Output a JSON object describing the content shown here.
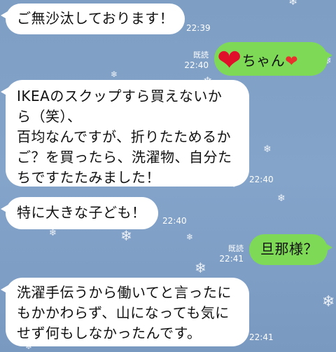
{
  "messages": [
    {
      "text": "ご無沙汰しております！",
      "time": "22:39"
    },
    {
      "prefix_icon": "heart-icon",
      "text": "ちゃん",
      "suffix_icon": "heart-icon",
      "read": "既読",
      "time": "22:40"
    },
    {
      "lines": [
        "IKEAのスクップすら買えないか",
        "ら（笑）、",
        "百均なんですが、折りたためるか",
        "ご？を買ったら、洗濯物、自分た",
        "ちですたたみました！"
      ],
      "time": "22:40"
    },
    {
      "text": "特に大きな子ども！",
      "time": "22:40"
    },
    {
      "text": "旦那様？",
      "read": "既読",
      "time": "22:41"
    },
    {
      "lines": [
        "洗濯手伝うから働いてと言ったに",
        "もかかわらず、山になっても気に",
        "せず何もしなかったんです。"
      ],
      "time": "22:41"
    }
  ],
  "colors": {
    "background": "#809fc5",
    "incoming_bubble": "#ffffff",
    "outgoing_bubble": "#7ed957",
    "meta_text": "#ffffff"
  },
  "icons": {
    "heart": "❤",
    "snowflake": "❄"
  }
}
